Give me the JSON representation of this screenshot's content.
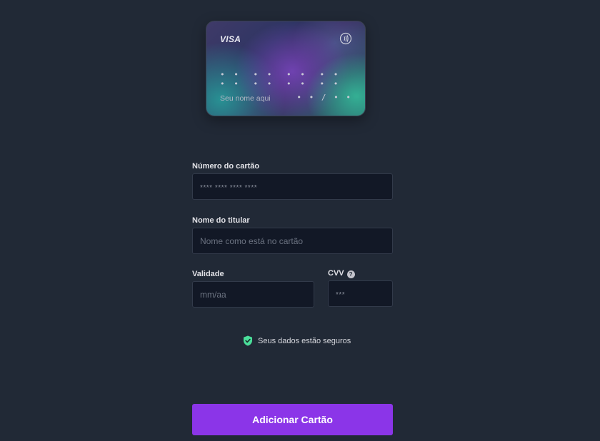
{
  "card_preview": {
    "brand": "VISA",
    "number_groups": [
      "• • • •",
      "• • • •",
      "• • • •",
      "• • • •"
    ],
    "holder_placeholder": "Seu nome aqui",
    "expiry_placeholder": "• • / • •"
  },
  "form": {
    "card_number": {
      "label": "Número do cartão",
      "placeholder": "**** **** **** ****"
    },
    "holder_name": {
      "label": "Nome do titular",
      "placeholder": "Nome como está no cartão"
    },
    "expiry": {
      "label": "Validade",
      "placeholder": "mm/aa"
    },
    "cvv": {
      "label": "CVV",
      "help_glyph": "?",
      "placeholder": "***"
    }
  },
  "security_note": "Seus dados estão seguros",
  "submit_label": "Adicionar Cartão",
  "colors": {
    "background": "#212936",
    "input_background": "#121826",
    "accent": "#8b35e8",
    "secure_icon": "#4ade9a"
  },
  "icons": {
    "contactless": "contactless-icon",
    "help": "question-circle-icon",
    "secure": "shield-check-icon"
  }
}
